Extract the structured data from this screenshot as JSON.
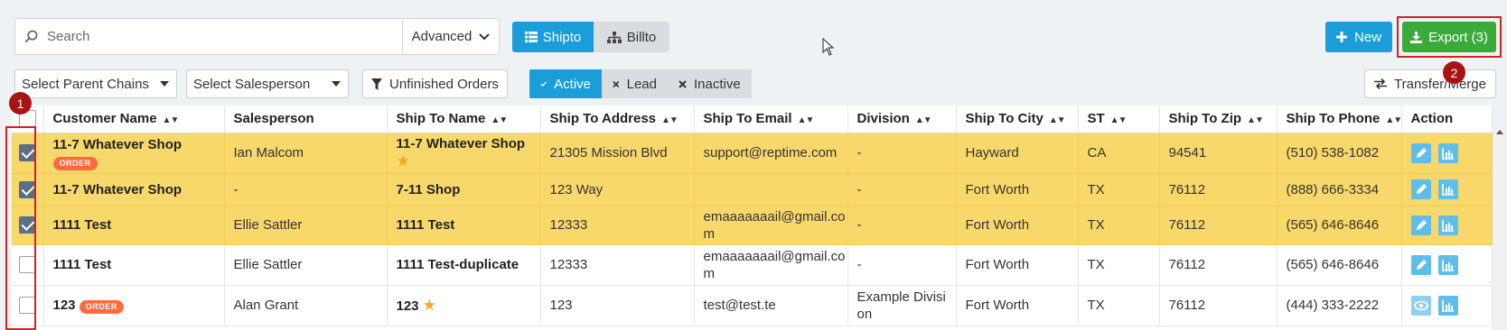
{
  "search": {
    "placeholder": "Search",
    "advanced_label": "Advanced"
  },
  "view_toggle": {
    "shipto_label": "Shipto",
    "billto_label": "Billto"
  },
  "actions": {
    "new_label": "New",
    "export_label": "Export (3)",
    "transfer_label": "Transfer/Merge"
  },
  "filters": {
    "parent_chains_placeholder": "Select Parent Chains",
    "salesperson_placeholder": "Select Salesperson",
    "unfinished_label": "Unfinished Orders",
    "status": {
      "active": "Active",
      "lead": "Lead",
      "inactive": "Inactive"
    }
  },
  "markers": {
    "one": "1",
    "two": "2"
  },
  "table": {
    "headers": [
      "Customer Name",
      "Salesperson",
      "Ship To Name",
      "Ship To Address",
      "Ship To Email",
      "Division",
      "Ship To City",
      "ST",
      "Ship To Zip",
      "Ship To Phone",
      "Action"
    ],
    "badge_label": "ORDER",
    "rows": [
      {
        "customer": "11-7 Whatever Shop",
        "salesperson": "Ian Malcom",
        "ship_to_name": "11-7 Whatever Shop",
        "address": "21305 Mission Blvd",
        "email": "support@reptime.com",
        "division": "-",
        "city": "Hayward",
        "st": "CA",
        "zip": "94541",
        "phone": "(510) 538-1082"
      },
      {
        "customer": "11-7 Whatever Shop",
        "salesperson": "-",
        "ship_to_name": "7-11 Shop",
        "address": "123 Way",
        "email": "",
        "division": "-",
        "city": "Fort Worth",
        "st": "TX",
        "zip": "76112",
        "phone": "(888) 666-3334"
      },
      {
        "customer": "1111 Test",
        "salesperson": "Ellie Sattler",
        "ship_to_name": "1111 Test",
        "address": "12333",
        "email": "emaaaaaaail@gmail.co m",
        "division": "-",
        "city": "Fort Worth",
        "st": "TX",
        "zip": "76112",
        "phone": "(565) 646-8646"
      },
      {
        "customer": "1111 Test",
        "salesperson": "Ellie Sattler",
        "ship_to_name": "1111 Test-duplicate",
        "address": "12333",
        "email": "emaaaaaaail@gmail.co m",
        "division": "-",
        "city": "Fort Worth",
        "st": "TX",
        "zip": "76112",
        "phone": "(565) 646-8646"
      },
      {
        "customer": "123",
        "salesperson": "Alan Grant",
        "ship_to_name": "123",
        "address": "123",
        "email": "test@test.te",
        "division": "Example Divisi on",
        "city": "Fort Worth",
        "st": "TX",
        "zip": "76112",
        "phone": "(444) 333-2222"
      }
    ]
  },
  "colors": {
    "primary": "#1a9dd9",
    "export": "#3aaa3a",
    "selected_row": "#f8d86a",
    "highlight": "#d32121",
    "badge": "#ff6a3d"
  }
}
